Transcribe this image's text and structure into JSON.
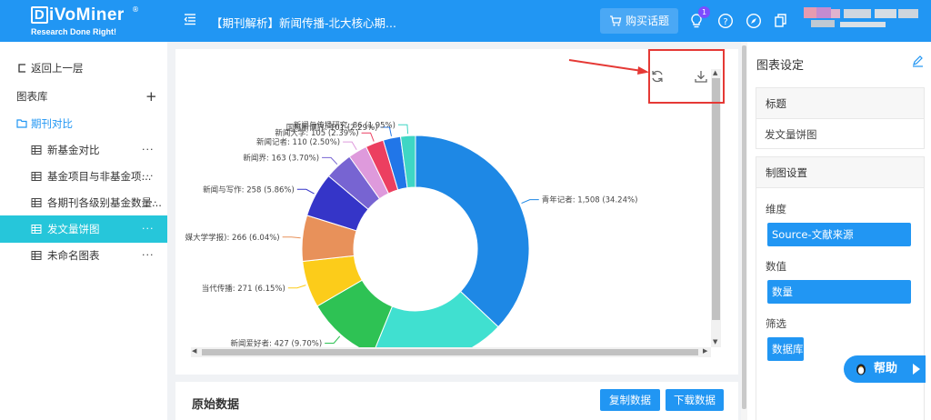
{
  "header": {
    "logo_main": "iVoMiner",
    "logo_letter": "D",
    "logo_reg": "®",
    "logo_sub": "Research Done Right!",
    "title": "【期刊解析】新闻传播-北大核心期...",
    "buy_label": "购买话题",
    "badge_count": "1"
  },
  "sidebar": {
    "back": "返回上一层",
    "library": "图表库",
    "plus": "+",
    "folder": "期刊对比",
    "more": "···",
    "items": [
      {
        "label": "新基金对比"
      },
      {
        "label": "基金项目与非基金项..."
      },
      {
        "label": "各期刊各级别基金数量..."
      },
      {
        "label": "发文量饼图"
      },
      {
        "label": "未命名图表"
      }
    ]
  },
  "chart_data": {
    "type": "pie",
    "donut": true,
    "title": "",
    "slices": [
      {
        "label": "青年记者: 1,508 (34.24%)",
        "value": 1508,
        "percent": 34.24,
        "color": "#1e88e5"
      },
      {
        "label": "",
        "value": 0,
        "percent": 17.7,
        "color": "#40e0d0"
      },
      {
        "label": "新闻爱好者: 427 (9.70%)",
        "value": 427,
        "percent": 9.7,
        "color": "#2ec254"
      },
      {
        "label": "当代传播: 271 (6.15%)",
        "value": 271,
        "percent": 6.15,
        "color": "#fccc1a"
      },
      {
        "label": "媒大学学报): 266 (6.04%)",
        "value": 266,
        "percent": 6.04,
        "color": "#e8915a"
      },
      {
        "label": "新闻与写作: 258 (5.86%)",
        "value": 258,
        "percent": 5.86,
        "color": "#3535c8"
      },
      {
        "label": "新闻界: 163 (3.70%)",
        "value": 163,
        "percent": 3.7,
        "color": "#7764d2"
      },
      {
        "label": "新闻记者: 110 (2.50%)",
        "value": 110,
        "percent": 2.5,
        "color": "#de9adc"
      },
      {
        "label": "新闻大学: 105 (2.39%)",
        "value": 105,
        "percent": 2.39,
        "color": "#ec3f60"
      },
      {
        "label": "国际新闻界: 101 (2.29%)",
        "value": 101,
        "percent": 2.29,
        "color": "#2176e8"
      },
      {
        "label": "新闻与传播研究: 86 (1.95%)",
        "value": 86,
        "percent": 1.95,
        "color": "#3fd6c4"
      }
    ]
  },
  "raw": {
    "title": "原始数据",
    "copy_label": "复制数据",
    "download_label": "下载数据"
  },
  "panel": {
    "title": "图表设定",
    "title_box": "标题",
    "title_value": "发文量饼图",
    "settings_box": "制图设置",
    "dimension_label": "维度",
    "dimension_value": "Source-文献来源",
    "measure_label": "数值",
    "measure_value": "数量",
    "filter_label": "筛选",
    "filter_value": "数据库"
  },
  "help": {
    "label": "帮助"
  },
  "colors": {
    "primary": "#2196f3",
    "active": "#26c6da",
    "highlight": "#e53935"
  }
}
